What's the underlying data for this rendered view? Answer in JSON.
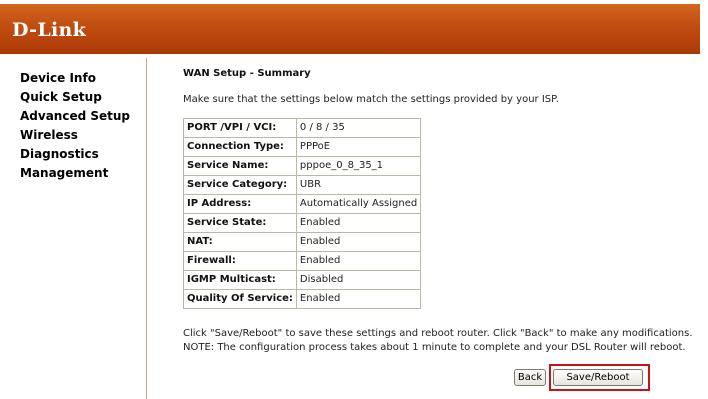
{
  "header": {
    "logo": "D-Link"
  },
  "sidebar": {
    "items": [
      {
        "label": "Device Info"
      },
      {
        "label": "Quick Setup"
      },
      {
        "label": "Advanced Setup"
      },
      {
        "label": "Wireless"
      },
      {
        "label": "Diagnostics"
      },
      {
        "label": "Management"
      }
    ]
  },
  "main": {
    "title": "WAN Setup - Summary",
    "instruction": "Make sure that the settings below match the settings provided by your ISP.",
    "summary_rows": [
      {
        "label": "PORT /VPI / VCI:",
        "value": "0 / 8 / 35"
      },
      {
        "label": "Connection Type:",
        "value": "PPPoE"
      },
      {
        "label": "Service Name:",
        "value": "pppoe_0_8_35_1"
      },
      {
        "label": "Service Category:",
        "value": "UBR"
      },
      {
        "label": "IP Address:",
        "value": "Automatically Assigned"
      },
      {
        "label": "Service State:",
        "value": "Enabled"
      },
      {
        "label": "NAT:",
        "value": "Enabled"
      },
      {
        "label": "Firewall:",
        "value": "Enabled"
      },
      {
        "label": "IGMP Multicast:",
        "value": "Disabled"
      },
      {
        "label": "Quality Of Service:",
        "value": "Enabled"
      }
    ],
    "note_line1": "Click \"Save/Reboot\" to save these settings and reboot router. Click \"Back\" to make any modifications.",
    "note_line2": "NOTE: The configuration process takes about 1 minute to complete and your DSL Router will reboot.",
    "back_label": "Back",
    "save_label": "Save/Reboot"
  },
  "colors": {
    "header_orange": "#c24f12",
    "highlight_red": "#c81419"
  }
}
